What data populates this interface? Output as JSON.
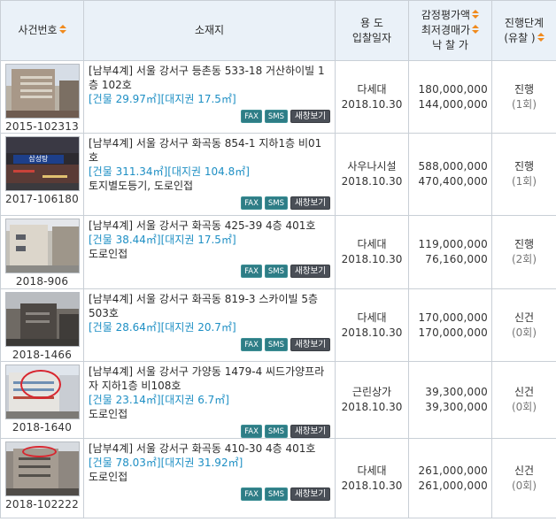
{
  "header": {
    "case_no": "사건번호",
    "location": "소재지",
    "use_line1": "용 도",
    "use_line2": "입찰일자",
    "price_line1": "감정평가액",
    "price_line2": "최저경매가",
    "price_line3": "낙 찰 가",
    "status_line1": "진행단계",
    "status_line2": "(유찰 )"
  },
  "buttons": {
    "fax": "FAX",
    "sms": "SMS",
    "view": "새창보기"
  },
  "rows": [
    {
      "case_no": "2015-102313",
      "address": "[남부4계] 서울 강서구 등촌동 533-18 거산하이빌 1층 102호",
      "area": "[건물 29.97㎡][대지권 17.5㎡]",
      "note": "",
      "use": "다세대",
      "date": "2018.10.30",
      "appraisal": "180,000,000",
      "min_bid": "144,000,000",
      "status": "진행",
      "count": "(1회)"
    },
    {
      "case_no": "2017-106180",
      "address": "[남부4계] 서울 강서구 화곡동 854-1 지하1층 비01호",
      "area": "[건물 311.34㎡][대지권 104.8㎡]",
      "note": "토지별도등기, 도로인접",
      "use": "사우나시설",
      "date": "2018.10.30",
      "appraisal": "588,000,000",
      "min_bid": "470,400,000",
      "status": "진행",
      "count": "(1회)"
    },
    {
      "case_no": "2018-906",
      "address": "[남부4계] 서울 강서구 화곡동 425-39 4층 401호",
      "area": "[건물 38.44㎡][대지권 17.5㎡]",
      "note": "도로인접",
      "use": "다세대",
      "date": "2018.10.30",
      "appraisal": "119,000,000",
      "min_bid": "76,160,000",
      "status": "진행",
      "count": "(2회)"
    },
    {
      "case_no": "2018-1466",
      "address": "[남부4계] 서울 강서구 화곡동 819-3 스카이빌 5층 503호",
      "area": "[건물 28.64㎡][대지권 20.7㎡]",
      "note": "",
      "use": "다세대",
      "date": "2018.10.30",
      "appraisal": "170,000,000",
      "min_bid": "170,000,000",
      "status": "신건",
      "count": "(0회)"
    },
    {
      "case_no": "2018-1640",
      "address": "[남부4계] 서울 강서구 가양동 1479-4 씨드가양프라자 지하1층 비108호",
      "area": "[건물 23.14㎡][대지권 6.7㎡]",
      "note": "도로인접",
      "use": "근린상가",
      "date": "2018.10.30",
      "appraisal": "39,300,000",
      "min_bid": "39,300,000",
      "status": "신건",
      "count": "(0회)"
    },
    {
      "case_no": "2018-102222",
      "address": "[남부4계] 서울 강서구 화곡동 410-30 4층 401호",
      "area": "[건물 78.03㎡][대지권 31.92㎡]",
      "note": "도로인접",
      "use": "다세대",
      "date": "2018.10.30",
      "appraisal": "261,000,000",
      "min_bid": "261,000,000",
      "status": "신건",
      "count": "(0회)"
    }
  ],
  "thumb_text": {
    "sign_row1": "삼성탕"
  },
  "colors": {
    "header_bg": "#eaf1f8",
    "sort_arrow": "#f08a1d",
    "area_text": "#1e8fc4",
    "btn_teal": "#2e7d86",
    "btn_dark": "#4a4f57"
  }
}
